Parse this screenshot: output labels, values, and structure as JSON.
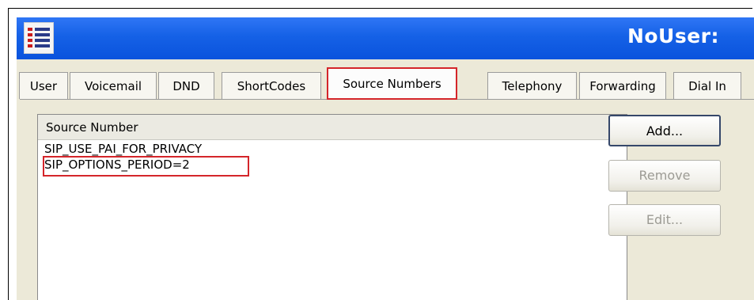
{
  "window": {
    "title": "NoUser:"
  },
  "tabs": [
    {
      "label": "User"
    },
    {
      "label": "Voicemail"
    },
    {
      "label": "DND"
    },
    {
      "label": "ShortCodes"
    },
    {
      "label": "Source Numbers",
      "active": true
    },
    {
      "label": "Telephony"
    },
    {
      "label": "Forwarding"
    },
    {
      "label": "Dial In"
    }
  ],
  "list": {
    "header": "Source Number",
    "rows": [
      "SIP_USE_PAI_FOR_PRIVACY",
      "SIP_OPTIONS_PERIOD=2"
    ]
  },
  "buttons": {
    "add": "Add...",
    "remove": "Remove",
    "edit": "Edit..."
  },
  "colors": {
    "titlebar": "#1561e6",
    "highlight": "#d4252a"
  }
}
